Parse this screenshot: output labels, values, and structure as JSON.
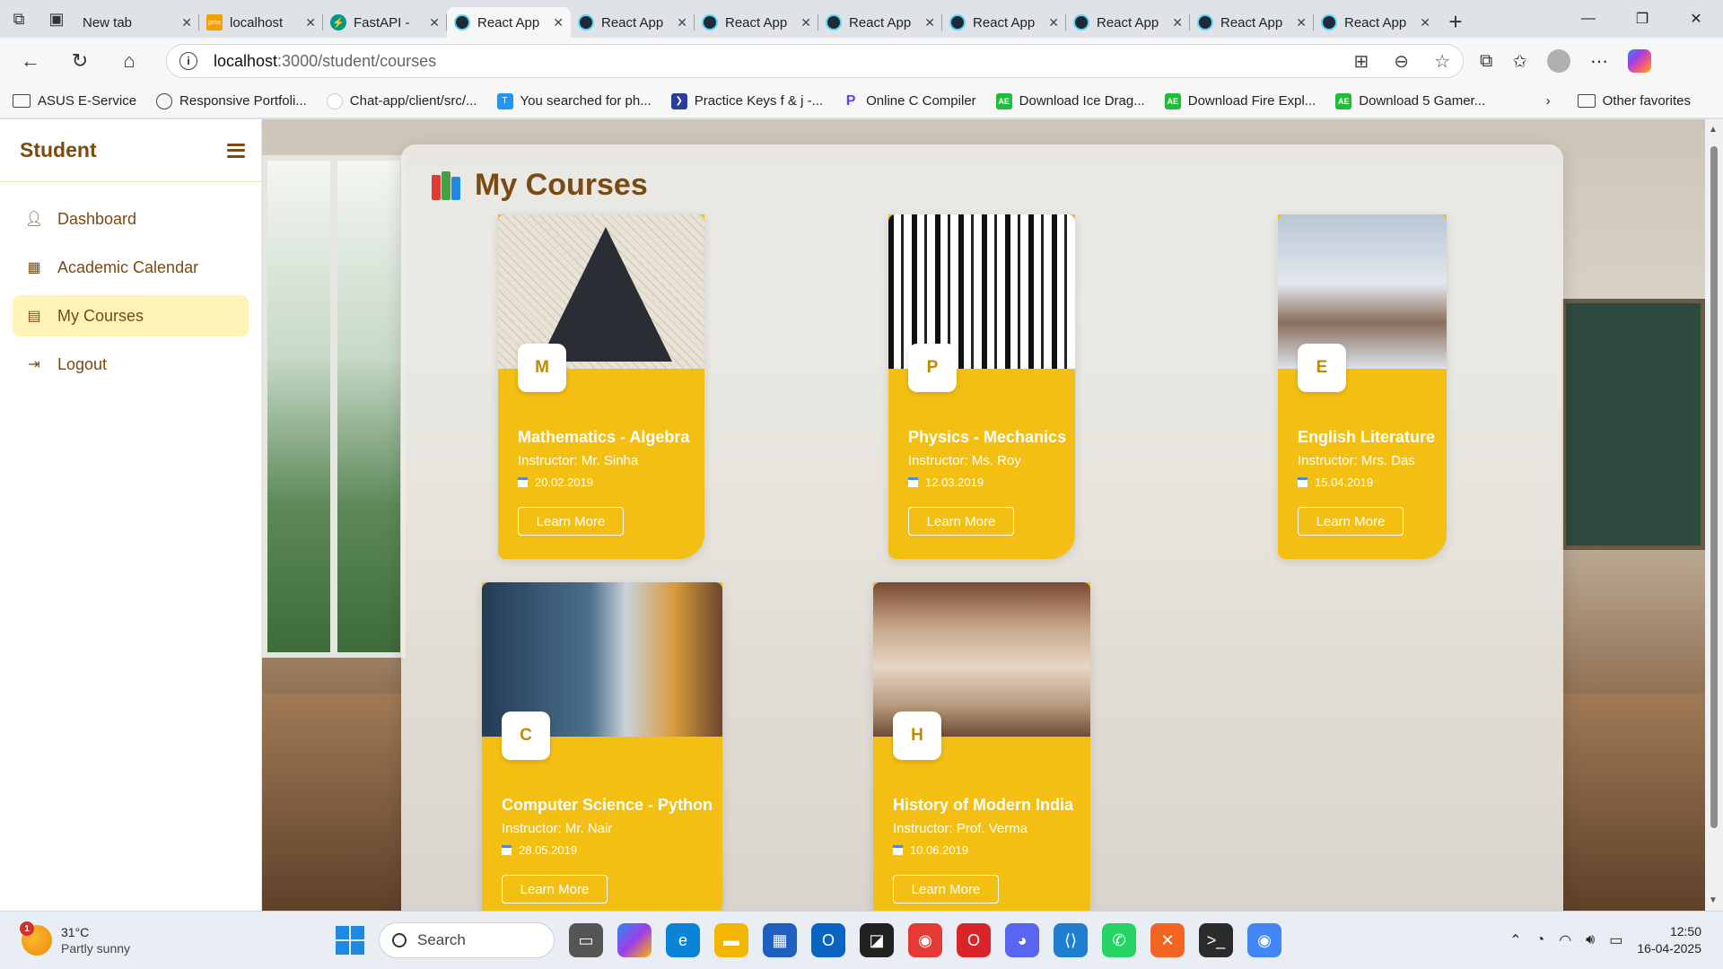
{
  "browser": {
    "tabs": [
      {
        "title": "New tab",
        "icon": "page-icon",
        "active": false
      },
      {
        "title": "localhost",
        "icon": "phpmyadmin-icon",
        "active": false
      },
      {
        "title": "FastAPI -",
        "icon": "fastapi-icon",
        "active": false
      },
      {
        "title": "React App",
        "icon": "react-icon",
        "active": true
      },
      {
        "title": "React App",
        "icon": "react-icon",
        "active": false
      },
      {
        "title": "React App",
        "icon": "react-icon",
        "active": false
      },
      {
        "title": "React App",
        "icon": "react-icon",
        "active": false
      },
      {
        "title": "React App",
        "icon": "react-icon",
        "active": false
      },
      {
        "title": "React App",
        "icon": "react-icon",
        "active": false
      },
      {
        "title": "React App",
        "icon": "react-icon",
        "active": false
      },
      {
        "title": "React App",
        "icon": "react-icon",
        "active": false
      }
    ],
    "url_host": "localhost",
    "url_path": ":3000/student/courses",
    "bookmarks": [
      {
        "label": "ASUS E-Service",
        "icon": "folder-icon"
      },
      {
        "label": "Responsive Portfoli...",
        "icon": "globe-icon"
      },
      {
        "label": "Chat-app/client/src/...",
        "icon": "github-icon"
      },
      {
        "label": "You searched for ph...",
        "icon": "stack-icon"
      },
      {
        "label": "Practice Keys f & j -...",
        "icon": "practice-icon"
      },
      {
        "label": "Online C Compiler",
        "icon": "compiler-icon"
      },
      {
        "label": "Download Ice Drag...",
        "icon": "ae-icon"
      },
      {
        "label": "Download Fire Expl...",
        "icon": "ae-icon"
      },
      {
        "label": "Download 5 Gamer...",
        "icon": "ae-icon"
      }
    ],
    "other_favorites": "Other favorites"
  },
  "sidebar": {
    "title": "Student",
    "items": [
      {
        "label": "Dashboard",
        "icon": "user-icon",
        "active": false
      },
      {
        "label": "Academic Calendar",
        "icon": "calendar-icon",
        "active": false
      },
      {
        "label": "My Courses",
        "icon": "book-icon",
        "active": true
      },
      {
        "label": "Logout",
        "icon": "logout-icon",
        "active": false
      }
    ]
  },
  "main": {
    "title": "My Courses",
    "courses": [
      {
        "letter": "M",
        "title": "Mathematics - Algebra",
        "instructor": "Instructor: Mr. Sinha",
        "date": "20.02.2019",
        "button": "Learn More"
      },
      {
        "letter": "P",
        "title": "Physics - Mechanics",
        "instructor": "Instructor: Ms. Roy",
        "date": "12.03.2019",
        "button": "Learn More"
      },
      {
        "letter": "E",
        "title": "English Literature",
        "instructor": "Instructor: Mrs. Das",
        "date": "15.04.2019",
        "button": "Learn More"
      },
      {
        "letter": "C",
        "title": "Computer Science - Python",
        "instructor": "Instructor: Mr. Nair",
        "date": "28.05.2019",
        "button": "Learn More"
      },
      {
        "letter": "H",
        "title": "History of Modern India",
        "instructor": "Instructor: Prof. Verma",
        "date": "10.06.2019",
        "button": "Learn More"
      }
    ]
  },
  "taskbar": {
    "weather_temp": "31°C",
    "weather_cond": "Partly sunny",
    "weather_badge": "1",
    "search_placeholder": "Search",
    "time": "12:50",
    "date": "16-04-2025"
  },
  "colors": {
    "accent": "#f3bf12",
    "brand_text": "#7a4a10",
    "active_nav_bg": "#fff4b8"
  }
}
